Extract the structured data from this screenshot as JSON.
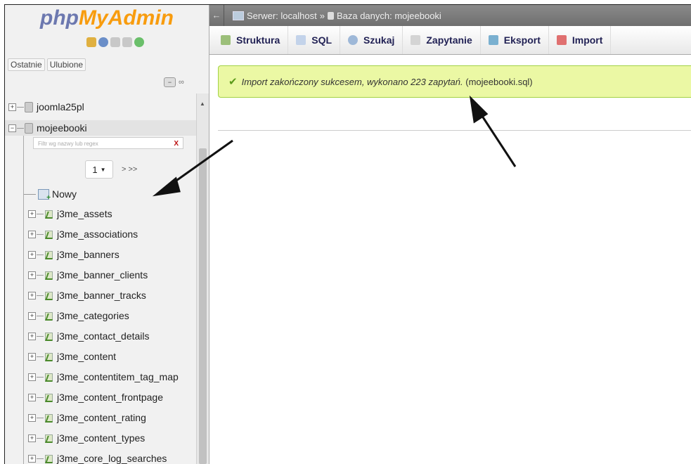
{
  "logo": {
    "part1": "php",
    "part2": "MyAdmin"
  },
  "recent_tabs": [
    "Ostatnie",
    "Ulubione"
  ],
  "tree": {
    "db1": "joomla25pl",
    "db2": "mojeebooki",
    "filter_placeholder": "Filtr wg nazwy lub regex",
    "filter_clear": "X",
    "page_value": "1",
    "page_next": "> >>",
    "new_label": "Nowy",
    "tables": [
      "j3me_assets",
      "j3me_associations",
      "j3me_banners",
      "j3me_banner_clients",
      "j3me_banner_tracks",
      "j3me_categories",
      "j3me_contact_details",
      "j3me_content",
      "j3me_contentitem_tag_map",
      "j3me_content_frontpage",
      "j3me_content_rating",
      "j3me_content_types",
      "j3me_core_log_searches"
    ]
  },
  "breadcrumb": {
    "server": "Serwer: localhost",
    "sep": "»",
    "database": "Baza danych: mojeebooki"
  },
  "tabs": [
    "Struktura",
    "SQL",
    "Szukaj",
    "Zapytanie",
    "Eksport",
    "Import"
  ],
  "message": {
    "italic": "Import zakończony sukcesem, wykonano 223 zapytań.",
    "file": "(mojeebooki.sql)"
  }
}
